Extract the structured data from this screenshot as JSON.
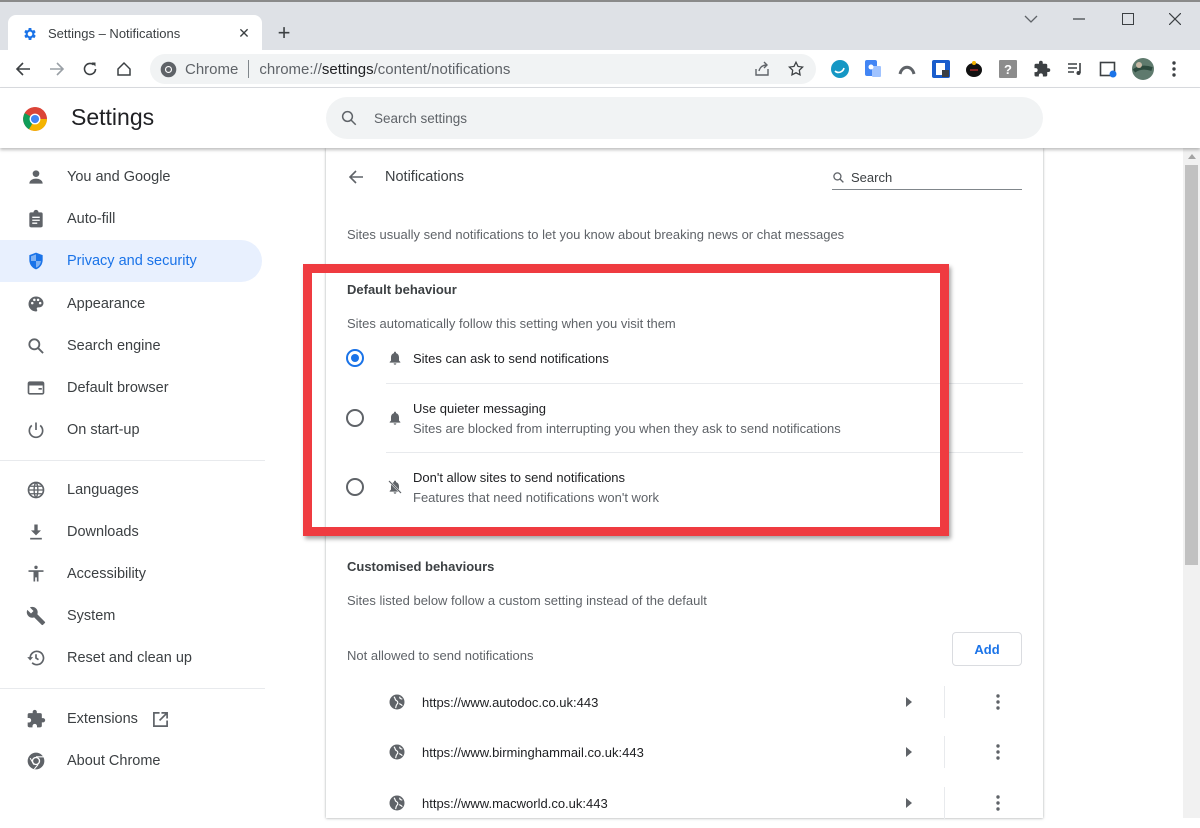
{
  "browser": {
    "tab": {
      "title": "Settings – Notifications",
      "favicon": "gear-icon",
      "close_icon": "close-icon"
    },
    "new_tab_icon": "plus-icon",
    "window_controls": [
      "chevron-down-icon",
      "minimize-icon",
      "maximize-icon",
      "close-icon"
    ],
    "nav": [
      "back-arrow-icon",
      "forward-arrow-icon",
      "reload-icon",
      "home-icon"
    ],
    "omnibox": {
      "site_chip": "Chrome",
      "url_prefix": "chrome://",
      "url_host": "settings",
      "url_path": "/content/notifications",
      "actions": [
        "share-icon",
        "bookmark-star-icon"
      ]
    },
    "extensions": [
      "blue-s-extension-icon",
      "translate-extension-icon",
      "arc-extension-icon",
      "lock-extension-icon",
      "dark-blob-extension-icon",
      "question-extension-icon",
      "puzzle-extensions-icon",
      "media-queue-icon",
      "side-panel-icon",
      "profile-avatar",
      "kebab-menu-icon"
    ]
  },
  "header": {
    "title": "Settings",
    "search_placeholder": "Search settings"
  },
  "sidebar": {
    "items": [
      {
        "label": "You and Google",
        "icon": "person-icon",
        "active": false
      },
      {
        "label": "Auto-fill",
        "icon": "clipboard-icon",
        "active": false
      },
      {
        "label": "Privacy and security",
        "icon": "shield-icon",
        "active": true
      },
      {
        "label": "Appearance",
        "icon": "palette-icon",
        "active": false
      },
      {
        "label": "Search engine",
        "icon": "search-icon",
        "active": false
      },
      {
        "label": "Default browser",
        "icon": "browser-window-icon",
        "active": false
      },
      {
        "label": "On start-up",
        "icon": "power-icon",
        "active": false
      },
      {
        "label": "Languages",
        "icon": "globe-icon",
        "active": false
      },
      {
        "label": "Downloads",
        "icon": "download-icon",
        "active": false
      },
      {
        "label": "Accessibility",
        "icon": "accessibility-icon",
        "active": false
      },
      {
        "label": "System",
        "icon": "wrench-icon",
        "active": false
      },
      {
        "label": "Reset and clean up",
        "icon": "history-icon",
        "active": false
      },
      {
        "label": "Extensions",
        "icon": "puzzle-icon",
        "active": false
      },
      {
        "label": "About Chrome",
        "icon": "chrome-icon",
        "active": false
      }
    ]
  },
  "main": {
    "subpage_title": "Notifications",
    "search_placeholder": "Search",
    "intro": "Sites usually send notifications to let you know about breaking news or chat messages",
    "default_behaviour": {
      "heading": "Default behaviour",
      "description": "Sites automatically follow this setting when you visit them",
      "options": [
        {
          "label": "Sites can ask to send notifications",
          "sublabel": "",
          "icon": "bell-icon",
          "checked": true
        },
        {
          "label": "Use quieter messaging",
          "sublabel": "Sites are blocked from interrupting you when they ask to send notifications",
          "icon": "bell-icon",
          "checked": false
        },
        {
          "label": "Don't allow sites to send notifications",
          "sublabel": "Features that need notifications won't work",
          "icon": "bell-off-icon",
          "checked": false
        }
      ]
    },
    "customised": {
      "heading": "Customised behaviours",
      "description": "Sites listed below follow a custom setting instead of the default",
      "blocked_label": "Not allowed to send notifications",
      "add_label": "Add",
      "sites": [
        "https://www.autodoc.co.uk:443",
        "https://www.birminghammail.co.uk:443",
        "https://www.macworld.co.uk:443"
      ]
    }
  },
  "colors": {
    "accent": "#1a73e8",
    "highlight_box": "#ef3b40",
    "active_nav_bg": "#e8f0fe"
  }
}
